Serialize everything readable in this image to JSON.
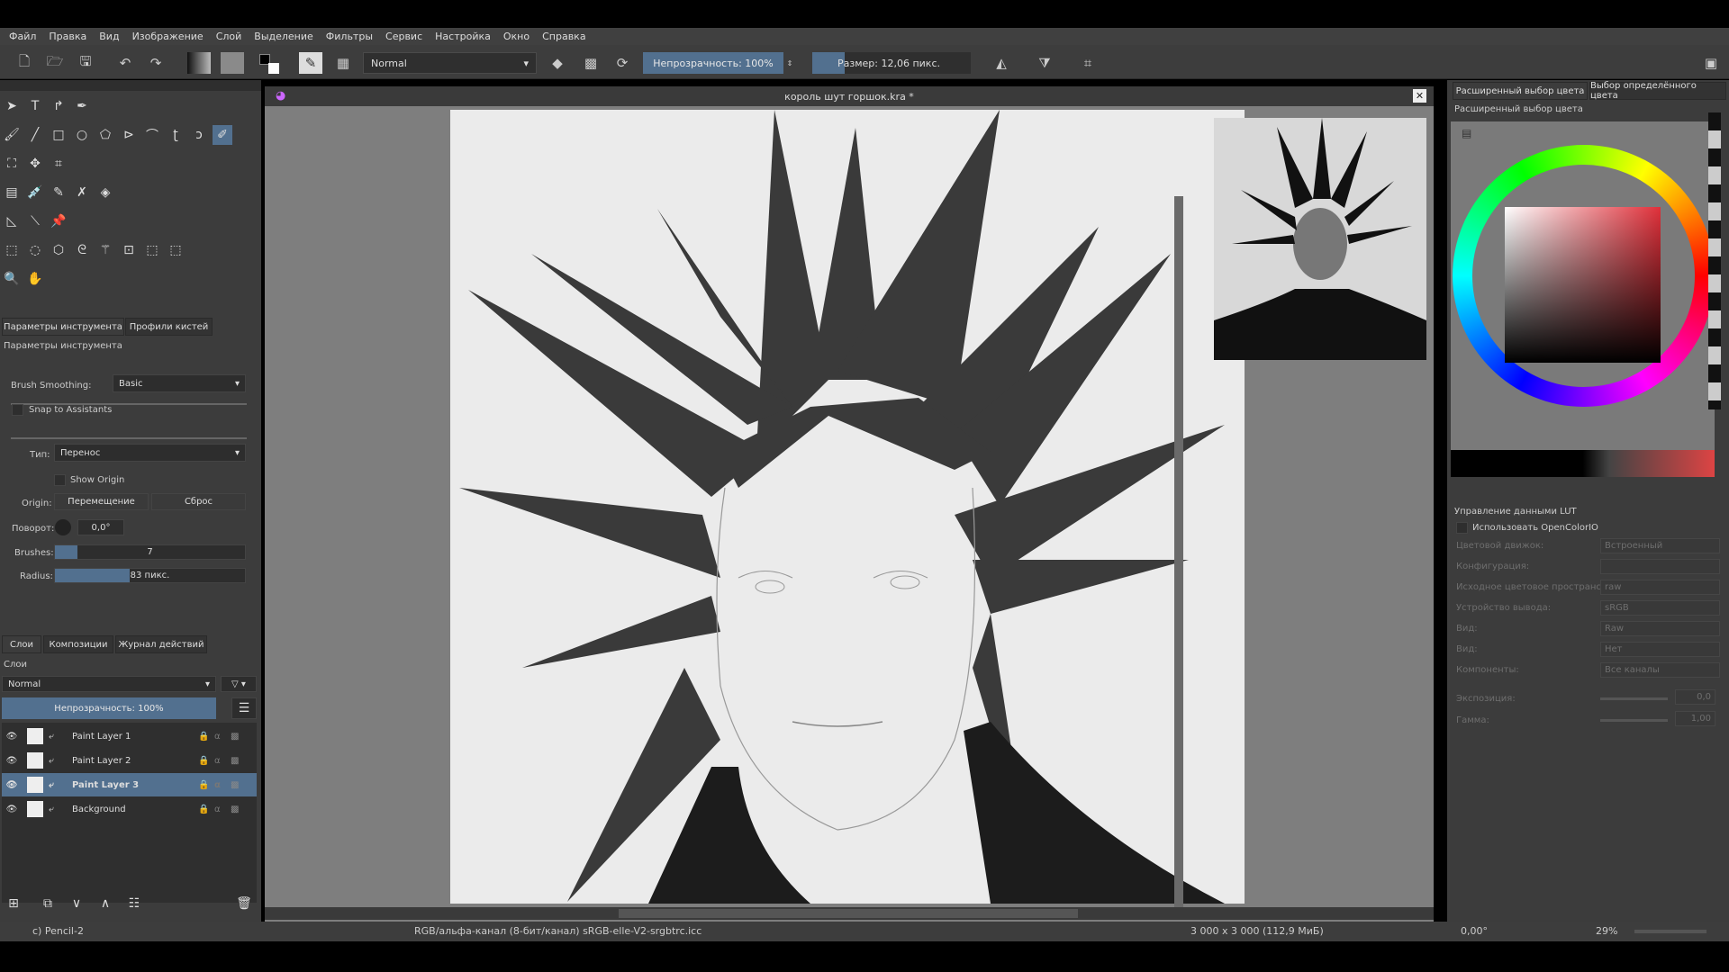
{
  "menu": [
    "Файл",
    "Правка",
    "Вид",
    "Изображение",
    "Слой",
    "Выделение",
    "Фильтры",
    "Сервис",
    "Настройка",
    "Окно",
    "Справка"
  ],
  "toolbar": {
    "blend_mode": "Normal",
    "opacity": "Непрозрачность: 100%",
    "size": "Размер: 12,06 пикс.",
    "opacity_fraction": 1.0
  },
  "document": {
    "title": "король шут горшок.kra *"
  },
  "tool_options": {
    "tabs": [
      "Параметры инструмента",
      "Профили кистей"
    ],
    "panel_title": "Параметры инструмента",
    "brush_smoothing_label": "Brush Smoothing:",
    "brush_smoothing": "Basic",
    "snap_label": "Snap to Assistants",
    "type_label": "Тип:",
    "type": "Перенос",
    "show_origin": "Show Origin",
    "origin_label": "Origin:",
    "origin_move": "Перемещение",
    "origin_reset": "Сброс",
    "rotation_label": "Поворот:",
    "rotation": "0,0°",
    "brushes_label": "Brushes:",
    "brushes": "7",
    "radius_label": "Radius:",
    "radius": "83 пикс."
  },
  "layers": {
    "tabs": [
      "Слои",
      "Композиции",
      "Журнал действий"
    ],
    "panel_title": "Слои",
    "blend_mode": "Normal",
    "opacity": "Непрозрачность:  100%",
    "items": [
      {
        "name": "Paint Layer 1",
        "selected": false
      },
      {
        "name": "Paint Layer 2",
        "selected": false
      },
      {
        "name": "Paint Layer 3",
        "selected": true
      },
      {
        "name": "Background",
        "selected": false
      }
    ]
  },
  "color": {
    "tabs": [
      "Расширенный выбор цвета",
      "Выбор определённого цвета"
    ],
    "panel_title": "Расширенный выбор цвета",
    "hue_color": "#e0303a"
  },
  "lut": {
    "title": "Управление данными LUT",
    "use_ocio": "Использовать OpenColorIO",
    "rows": [
      {
        "label": "Цветовой движок:",
        "value": "Встроенный"
      },
      {
        "label": "Конфигурация:",
        "value": ""
      },
      {
        "label": "Исходное цветовое пространство:",
        "value": "raw"
      },
      {
        "label": "Устройство вывода:",
        "value": "sRGB"
      },
      {
        "label": "Вид:",
        "value": "Raw"
      },
      {
        "label": "Вид:",
        "value": "Нет"
      },
      {
        "label": "Компоненты:",
        "value": "Все каналы"
      }
    ],
    "exposure_label": "Экспозиция:",
    "exposure": "0,0",
    "gamma_label": "Гамма:",
    "gamma": "1,00",
    "config_button": "..."
  },
  "status": {
    "brush": "c) Pencil-2",
    "color_space": "RGB/альфа-канал (8-бит/канал)  sRGB-elle-V2-srgbtrc.icc",
    "dimensions": "3 000 x 3 000 (112,9 МиБ)",
    "rotation": "0,00°",
    "zoom": "29%"
  }
}
